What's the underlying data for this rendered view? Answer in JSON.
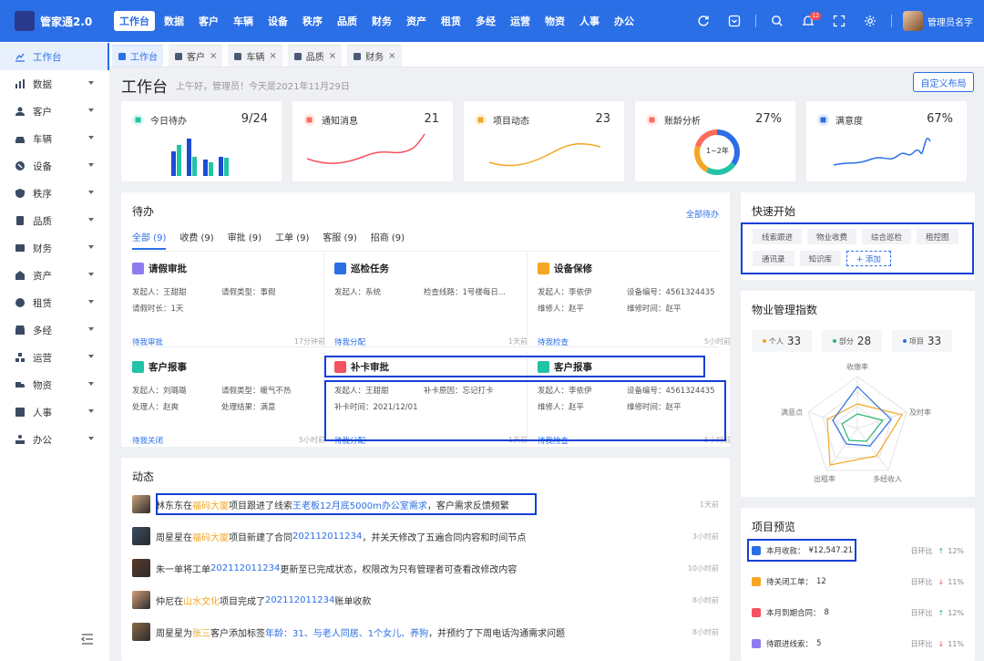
{
  "app": {
    "name": "管家通2.0"
  },
  "topnav": [
    "工作台",
    "数据",
    "客户",
    "车辆",
    "设备",
    "秩序",
    "品质",
    "财务",
    "资产",
    "租赁",
    "多经",
    "运营",
    "物资",
    "人事",
    "办公"
  ],
  "user": {
    "name": "管理员名字",
    "notification_count": "12"
  },
  "sidebar": [
    {
      "label": "工作台",
      "icon": "dashboard-icon"
    },
    {
      "label": "数据",
      "icon": "chart-icon"
    },
    {
      "label": "客户",
      "icon": "customer-icon"
    },
    {
      "label": "车辆",
      "icon": "car-icon"
    },
    {
      "label": "设备",
      "icon": "device-icon"
    },
    {
      "label": "秩序",
      "icon": "shield-icon"
    },
    {
      "label": "品质",
      "icon": "quality-icon"
    },
    {
      "label": "财务",
      "icon": "finance-icon"
    },
    {
      "label": "资产",
      "icon": "asset-icon"
    },
    {
      "label": "租赁",
      "icon": "lease-icon"
    },
    {
      "label": "多经",
      "icon": "store-icon"
    },
    {
      "label": "运营",
      "icon": "operation-icon"
    },
    {
      "label": "物资",
      "icon": "truck-icon"
    },
    {
      "label": "人事",
      "icon": "personnel-icon"
    },
    {
      "label": "办公",
      "icon": "office-icon"
    }
  ],
  "tabs": [
    "工作台",
    "客户",
    "车辆",
    "品质",
    "财务"
  ],
  "header": {
    "title": "工作台",
    "greeting": "上午好，管理员！今天是2021年11月29日",
    "custom_button": "自定义布局"
  },
  "stats": [
    {
      "title": "今日待办",
      "value": "9/24",
      "color": "#22c3a6"
    },
    {
      "title": "通知消息",
      "value": "21",
      "color": "#ff6b5b"
    },
    {
      "title": "项目动态",
      "value": "23",
      "color": "#f5a623"
    },
    {
      "title": "账龄分析",
      "value": "27%",
      "color": "#ff6b5b",
      "ring_label": "1~2年"
    },
    {
      "title": "满意度",
      "value": "67%",
      "color": "#2b6fe6"
    }
  ],
  "todo": {
    "title": "待办",
    "all_link": "全部待办",
    "tabs": [
      "全部 (9)",
      "收费 (9)",
      "审批 (9)",
      "工单 (9)",
      "客服 (9)",
      "招商 (9)"
    ],
    "cards": [
      {
        "title": "请假审批",
        "color": "#8c7cf0",
        "kv": [
          "发起人：王甜甜",
          "请假类型：事假",
          "请假时长：1天"
        ],
        "action": "待我审批",
        "time": "17分钟前"
      },
      {
        "title": "巡检任务",
        "color": "#2b6fe6",
        "kv": [
          "发起人：系统",
          "检查线路：1号楼每日...",
          ""
        ],
        "action": "待我分配",
        "time": "1天前"
      },
      {
        "title": "设备保修",
        "color": "#f5a623",
        "kv": [
          "发起人：李依伊",
          "设备编号：4561324435",
          "维修人：赵平",
          "维修时间：赵平"
        ],
        "action": "待我检查",
        "time": "5小时前"
      },
      {
        "title": "客户报事",
        "color": "#22c3a6",
        "kv": [
          "发起人：刘璐璐",
          "请假类型：暖气不热",
          "处理人：赵爽",
          "处理结果：满意"
        ],
        "action": "待我关闭",
        "time": "5小时前"
      },
      {
        "title": "补卡审批",
        "color": "#f5515f",
        "kv": [
          "发起人：王甜甜",
          "补卡原因：忘记打卡",
          "补卡时间：2021/12/01"
        ],
        "action": "待我分配",
        "time": "1天前"
      },
      {
        "title": "客户报事",
        "color": "#22c3a6",
        "kv": [
          "发起人：李依伊",
          "设备编号：4561324435",
          "维修人：赵平",
          "维修时间：赵平"
        ],
        "action": "待我检查",
        "time": "5小时前"
      }
    ]
  },
  "dynamics": {
    "title": "动态",
    "rows": [
      {
        "parts": [
          {
            "t": "林东东在",
            "c": ""
          },
          {
            "t": "福码大厦",
            "c": "orange"
          },
          {
            "t": "项目跟进了线索",
            "c": ""
          },
          {
            "t": "王老板12月底5000m办公室需求",
            "c": "blue"
          },
          {
            "t": "，客户需求反馈频繁",
            "c": ""
          }
        ],
        "time": "1天前"
      },
      {
        "parts": [
          {
            "t": "周星星在",
            "c": ""
          },
          {
            "t": "福码大厦",
            "c": "orange"
          },
          {
            "t": "项目新建了合同",
            "c": ""
          },
          {
            "t": "202112011234",
            "c": "blue"
          },
          {
            "t": "，并关天修改了五遍合同内容和时间节点",
            "c": ""
          }
        ],
        "time": "3小时前"
      },
      {
        "parts": [
          {
            "t": "朱一单将工单",
            "c": ""
          },
          {
            "t": "202112011234",
            "c": "blue"
          },
          {
            "t": "更新至已完成状态，权限改为只有管理者可查看改修改内容",
            "c": ""
          }
        ],
        "time": "10小时前"
      },
      {
        "parts": [
          {
            "t": "仲尼在",
            "c": ""
          },
          {
            "t": "山水文化",
            "c": "orange"
          },
          {
            "t": "项目完成了",
            "c": ""
          },
          {
            "t": "202112011234",
            "c": "blue"
          },
          {
            "t": "账单收款",
            "c": ""
          }
        ],
        "time": "8小时前"
      },
      {
        "parts": [
          {
            "t": "周星星为",
            "c": ""
          },
          {
            "t": "张三",
            "c": "orange"
          },
          {
            "t": "客户添加标签",
            "c": ""
          },
          {
            "t": "年龄：31、与老人同居、1个女儿、养狗",
            "c": "blue"
          },
          {
            "t": "，并预约了下周电话沟通需求问题",
            "c": ""
          }
        ],
        "time": "8小时前"
      }
    ]
  },
  "quick_start": {
    "title": "快速开始",
    "items": [
      "线索跟进",
      "物业收费",
      "综合巡检",
      "租控图",
      "通讯录",
      "知识库"
    ],
    "add": "+ 添加"
  },
  "index": {
    "title": "物业管理指数",
    "chips": [
      {
        "label": "个人",
        "value": "33",
        "color": "#f5a623"
      },
      {
        "label": "部分",
        "value": "28",
        "color": "#2bb673"
      },
      {
        "label": "项目",
        "value": "33",
        "color": "#2b6fe6"
      }
    ],
    "radar_labels": [
      "收缴率",
      "及时率",
      "多经收入",
      "出租率",
      "满意点"
    ]
  },
  "projects": {
    "title": "项目预览",
    "rows": [
      {
        "label": "本月收款：",
        "value": "¥12,547.21",
        "compare": "日环比",
        "trend": "↑",
        "pct": "12%",
        "color": "#2b6fe6",
        "dir": "up"
      },
      {
        "label": "待关闭工单：",
        "value": "12",
        "compare": "日环比",
        "trend": "↓",
        "pct": "11%",
        "color": "#f5a623",
        "dir": "down"
      },
      {
        "label": "本月到期合同：",
        "value": "8",
        "compare": "日环比",
        "trend": "↑",
        "pct": "12%",
        "color": "#f5515f",
        "dir": "up"
      },
      {
        "label": "待跟进线索：",
        "value": "5",
        "compare": "日环比",
        "trend": "↓",
        "pct": "11%",
        "color": "#8c7cf0",
        "dir": "down"
      }
    ]
  }
}
